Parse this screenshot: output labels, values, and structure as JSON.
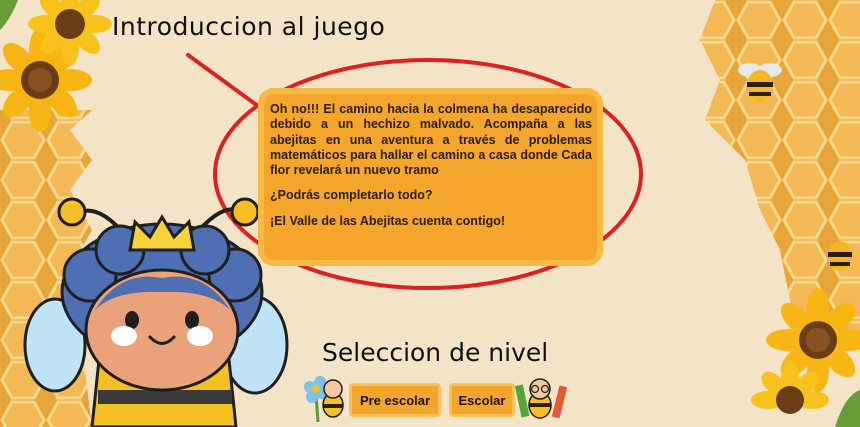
{
  "header": {
    "title": "Introduccion al juego"
  },
  "intro": {
    "paragraph1": "Oh no!!! El camino hacia la colmena ha desaparecido debido a un hechizo malvado. Acompaña a las abejitas en una aventura a través de problemas matemáticos para hallar el camino a casa donde Cada flor revelará un nuevo tramo",
    "paragraph2": "¿Podrás completarlo todo?",
    "paragraph3": "¡El Valle de las Abejitas cuenta contigo!"
  },
  "levels": {
    "title": "Seleccion de nivel",
    "pre_escolar_label": "Pre escolar",
    "escolar_label": "Escolar"
  },
  "colors": {
    "background": "#f3e4c7",
    "honey": "#f4a52c",
    "annotation_red": "#e01f1f"
  },
  "icons": [
    "sunflower-icon",
    "honeycomb-icon",
    "bee-icon",
    "queen-bee-mascot",
    "flower-bee-icon",
    "student-bee-icon"
  ]
}
